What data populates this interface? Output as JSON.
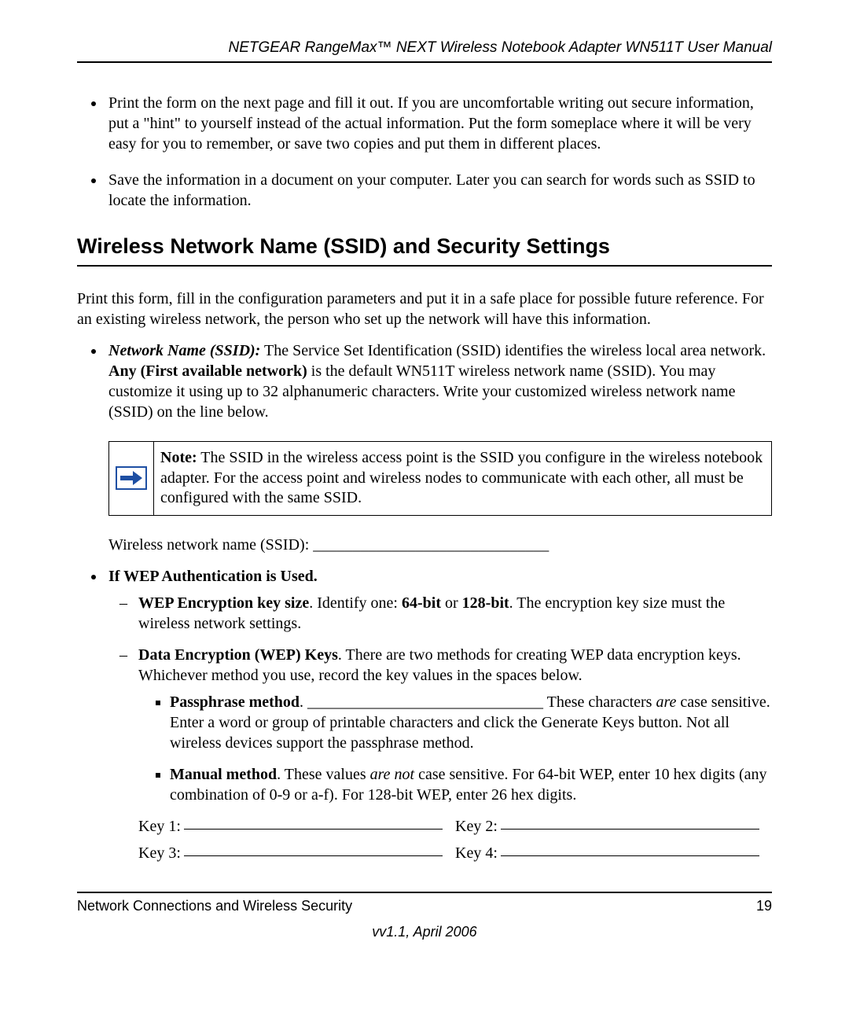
{
  "header": "NETGEAR RangeMax™ NEXT Wireless Notebook Adapter WN511T User Manual",
  "bullets_top": [
    "Print the form on the next page and fill it out. If you are uncomfortable writing out secure information, put a \"hint\" to yourself instead of the actual information. Put the form someplace where it will be very easy for you to remember, or save two copies and put them in different places.",
    "Save the information in a document on your computer. Later you can search for words such as SSID to locate the information."
  ],
  "section_title": "Wireless Network Name (SSID) and Security Settings",
  "intro": "Print this form, fill in the configuration parameters and put it in a safe place for possible future reference. For an existing wireless network, the person who set up the network will have this information.",
  "ssid": {
    "label_bold": "Network Name (SSID):",
    "text_before": " The Service Set Identification (SSID) identifies the wireless local area network. ",
    "bold_mid": "Any (First available network)",
    "text_after": " is the default WN511T wireless network name (SSID). You may customize it using up to 32 alphanumeric characters. Write your customized wireless network name (SSID) on the line below."
  },
  "note": {
    "label": "Note:",
    "text": " The SSID in the wireless access point is the SSID you configure in the wireless notebook adapter. For the access point and wireless nodes to communicate with each other, all must be configured with the same SSID."
  },
  "ssid_form_label": "Wireless network name (SSID): ______________________________",
  "wep_heading": "If WEP Authentication is Used.",
  "wep_keysize": {
    "bold": "WEP Encryption key size",
    "after": ". Identify one: ",
    "b1": "64-bit",
    "mid": " or ",
    "b2": "128-bit",
    "tail": ". The encryption key size must the wireless network settings."
  },
  "wep_keys_intro": {
    "bold": "Data Encryption (WEP) Keys",
    "after": ". There are two methods for creating WEP data encryption keys. Whichever method you use, record the key values in the spaces below."
  },
  "passphrase": {
    "bold": "Passphrase method",
    "blank": ". ______________________________ These characters ",
    "italic": "are",
    "tail": " case sensitive. Enter a word or group of printable characters and click the Generate Keys button. Not all wireless devices support the passphrase method."
  },
  "manual": {
    "bold": "Manual method",
    "before": ". These values ",
    "italic": "are not",
    "tail": " case sensitive. For 64-bit WEP, enter 10 hex digits (any combination of 0-9 or a-f). For 128-bit WEP, enter 26 hex digits."
  },
  "keys": {
    "k1": "Key 1:",
    "k2": "Key 2:",
    "k3": "Key 3:",
    "k4": "Key 4:"
  },
  "footer": {
    "left": "Network Connections and Wireless Security",
    "right": "19"
  },
  "version": "vv1.1, April 2006"
}
